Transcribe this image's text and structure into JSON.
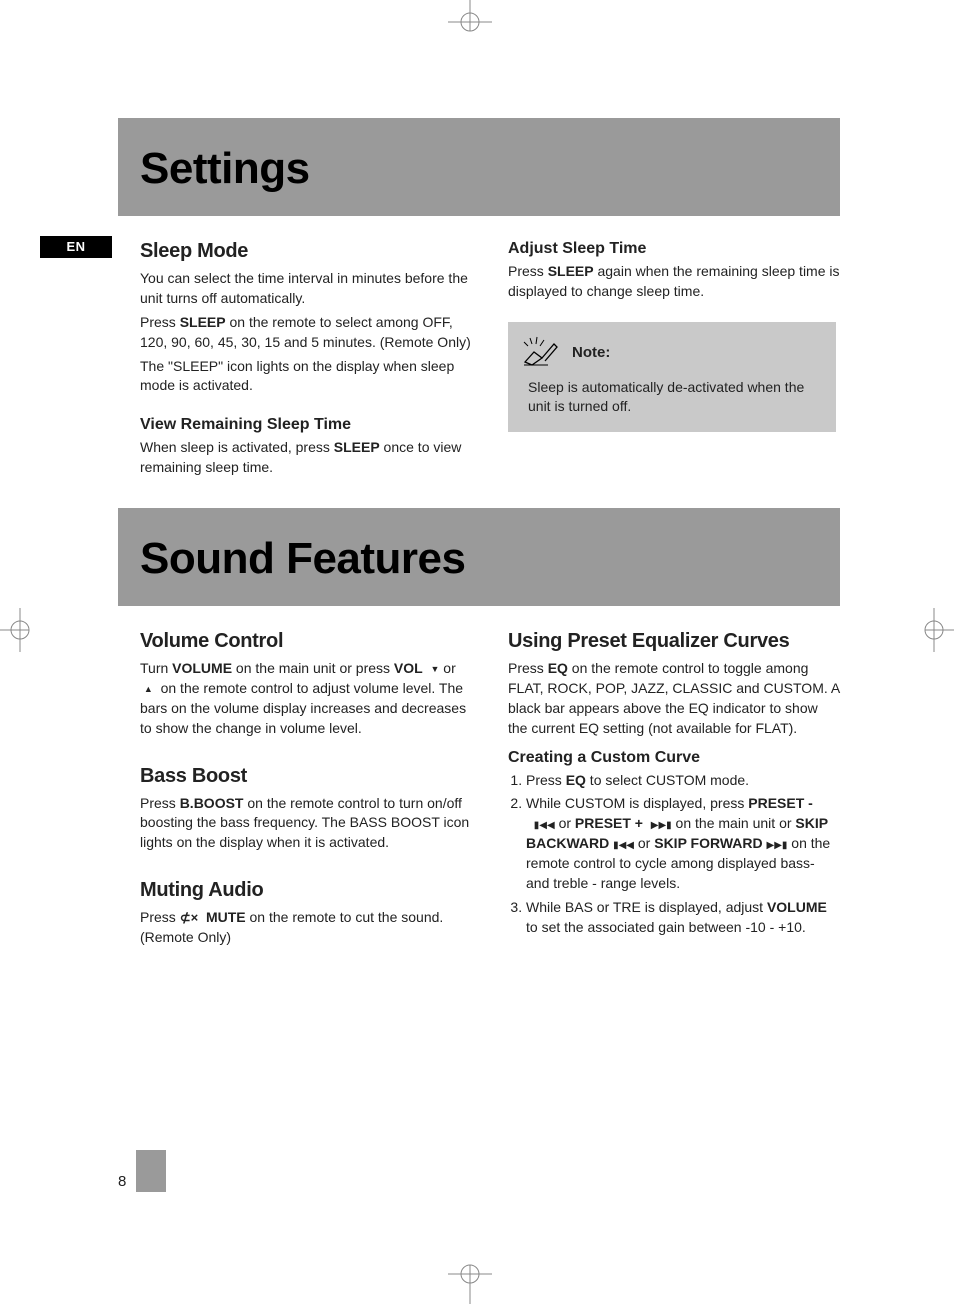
{
  "langTab": "EN",
  "banner1": "Settings",
  "banner2": "Sound Features",
  "sleep": {
    "title": "Sleep Mode",
    "p1a": "You can select the time interval in minutes before the unit turns off automatically.",
    "p2a": "Press ",
    "p2b": "SLEEP",
    "p2c": " on the remote to select among OFF, 120, 90, 60, 45, 30, 15 and  5 minutes.  (Remote Only)",
    "p3": "The \"SLEEP\" icon lights on the display when sleep mode is activated.",
    "viewTitle": "View Remaining Sleep Time",
    "viewP_a": "When sleep is activated, press ",
    "viewP_b": "SLEEP",
    "viewP_c": " once to view remaining sleep time."
  },
  "adjust": {
    "title": "Adjust Sleep Time",
    "p_a": "Press ",
    "p_b": "SLEEP",
    "p_c": " again when the remaining sleep time is displayed to change sleep time."
  },
  "note": {
    "label": "Note:",
    "text": "Sleep is automatically de-activated when the unit is turned off."
  },
  "volume": {
    "title": "Volume Control",
    "p_a": "Turn ",
    "p_b": "VOLUME",
    "p_c": "  on the main unit or press ",
    "p_d": "VOL",
    "p_e": "or ",
    "p_f": "on the remote control to adjust volume level. The bars on the volume display increases and decreases to show the change in volume level."
  },
  "bass": {
    "title": "Bass Boost",
    "p_a": "Press ",
    "p_b": "B.BOOST",
    "p_c": "  on the remote control to turn on/off boosting the bass frequency. The BASS BOOST icon lights on the display when it is activated."
  },
  "mute": {
    "title": "Muting Audio",
    "p_a": "Press  ",
    "p_b": "MUTE",
    "p_c": " on the remote to cut the sound. (Remote Only)"
  },
  "eq": {
    "title": "Using Preset Equalizer Curves",
    "p_a": "Press ",
    "p_b": "EQ",
    "p_c": "  on the remote control to toggle among FLAT, ROCK, POP, JAZZ, CLASSIC and CUSTOM.  A black bar appears above the EQ indicator to show the current EQ setting (not available for FLAT).",
    "customTitle": "Creating a Custom Curve",
    "s1a": "Press ",
    "s1b": "EQ",
    "s1c": " to select CUSTOM mode.",
    "s2a": "While CUSTOM is displayed, press ",
    "s2b": "PRESET -",
    "s2c": "or ",
    "s2d": "PRESET +",
    "s2e": "  on the main unit or ",
    "s2f": "SKIP BACKWARD",
    "s2g": " or ",
    "s2h": "SKIP FORWARD",
    "s2i": "  on the remote control to cycle  among displayed bass-  and treble - range levels.",
    "s3a": "While BAS or TRE is displayed, adjust ",
    "s3b": "VOLUME",
    "s3c": " to set the associated gain between -10 - +10."
  },
  "pageNumber": "8"
}
